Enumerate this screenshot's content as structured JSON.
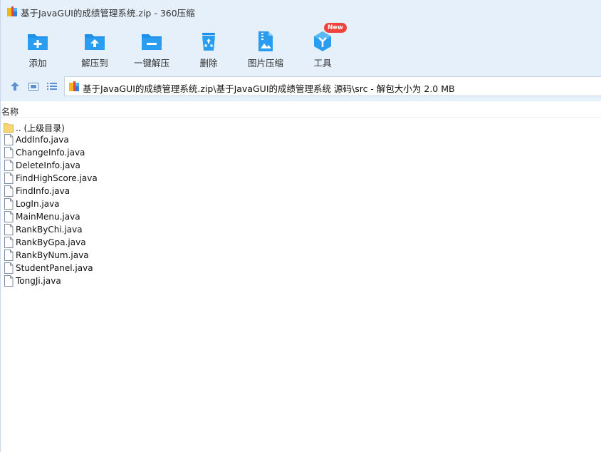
{
  "window": {
    "title": "基于JavaGUI的成绩管理系统.zip - 360压缩"
  },
  "toolbar": {
    "items": [
      {
        "label": "添加",
        "icon": "add-folder-icon"
      },
      {
        "label": "解压到",
        "icon": "extract-to-folder-icon"
      },
      {
        "label": "一键解压",
        "icon": "one-click-extract-icon"
      },
      {
        "label": "删除",
        "icon": "recycle-bin-icon"
      },
      {
        "label": "图片压缩",
        "icon": "image-compress-icon"
      },
      {
        "label": "工具",
        "icon": "tools-hexagon-icon"
      }
    ],
    "badge": "New"
  },
  "address": {
    "path": "基于JavaGUI的成绩管理系统.zip\\基于JavaGUI的成绩管理系统 源码\\src - 解包大小为 2.0 MB"
  },
  "list": {
    "column_name": "名称",
    "files": [
      {
        "name": ".. (上级目录)",
        "type": "folder"
      },
      {
        "name": "AddInfo.java",
        "type": "file"
      },
      {
        "name": "ChangeInfo.java",
        "type": "file"
      },
      {
        "name": "DeleteInfo.java",
        "type": "file"
      },
      {
        "name": "FindHighScore.java",
        "type": "file"
      },
      {
        "name": "FindInfo.java",
        "type": "file"
      },
      {
        "name": "LogIn.java",
        "type": "file"
      },
      {
        "name": "MainMenu.java",
        "type": "file"
      },
      {
        "name": "RankByChi.java",
        "type": "file"
      },
      {
        "name": "RankByGpa.java",
        "type": "file"
      },
      {
        "name": "RankByNum.java",
        "type": "file"
      },
      {
        "name": "StudentPanel.java",
        "type": "file"
      },
      {
        "name": "TongJi.java",
        "type": "file"
      }
    ]
  },
  "colors": {
    "toolbar_bg": "#e6f0fa",
    "icon_blue": "#1e90e8",
    "badge_red": "#f0433c",
    "folder_yellow": "#f7d675"
  }
}
